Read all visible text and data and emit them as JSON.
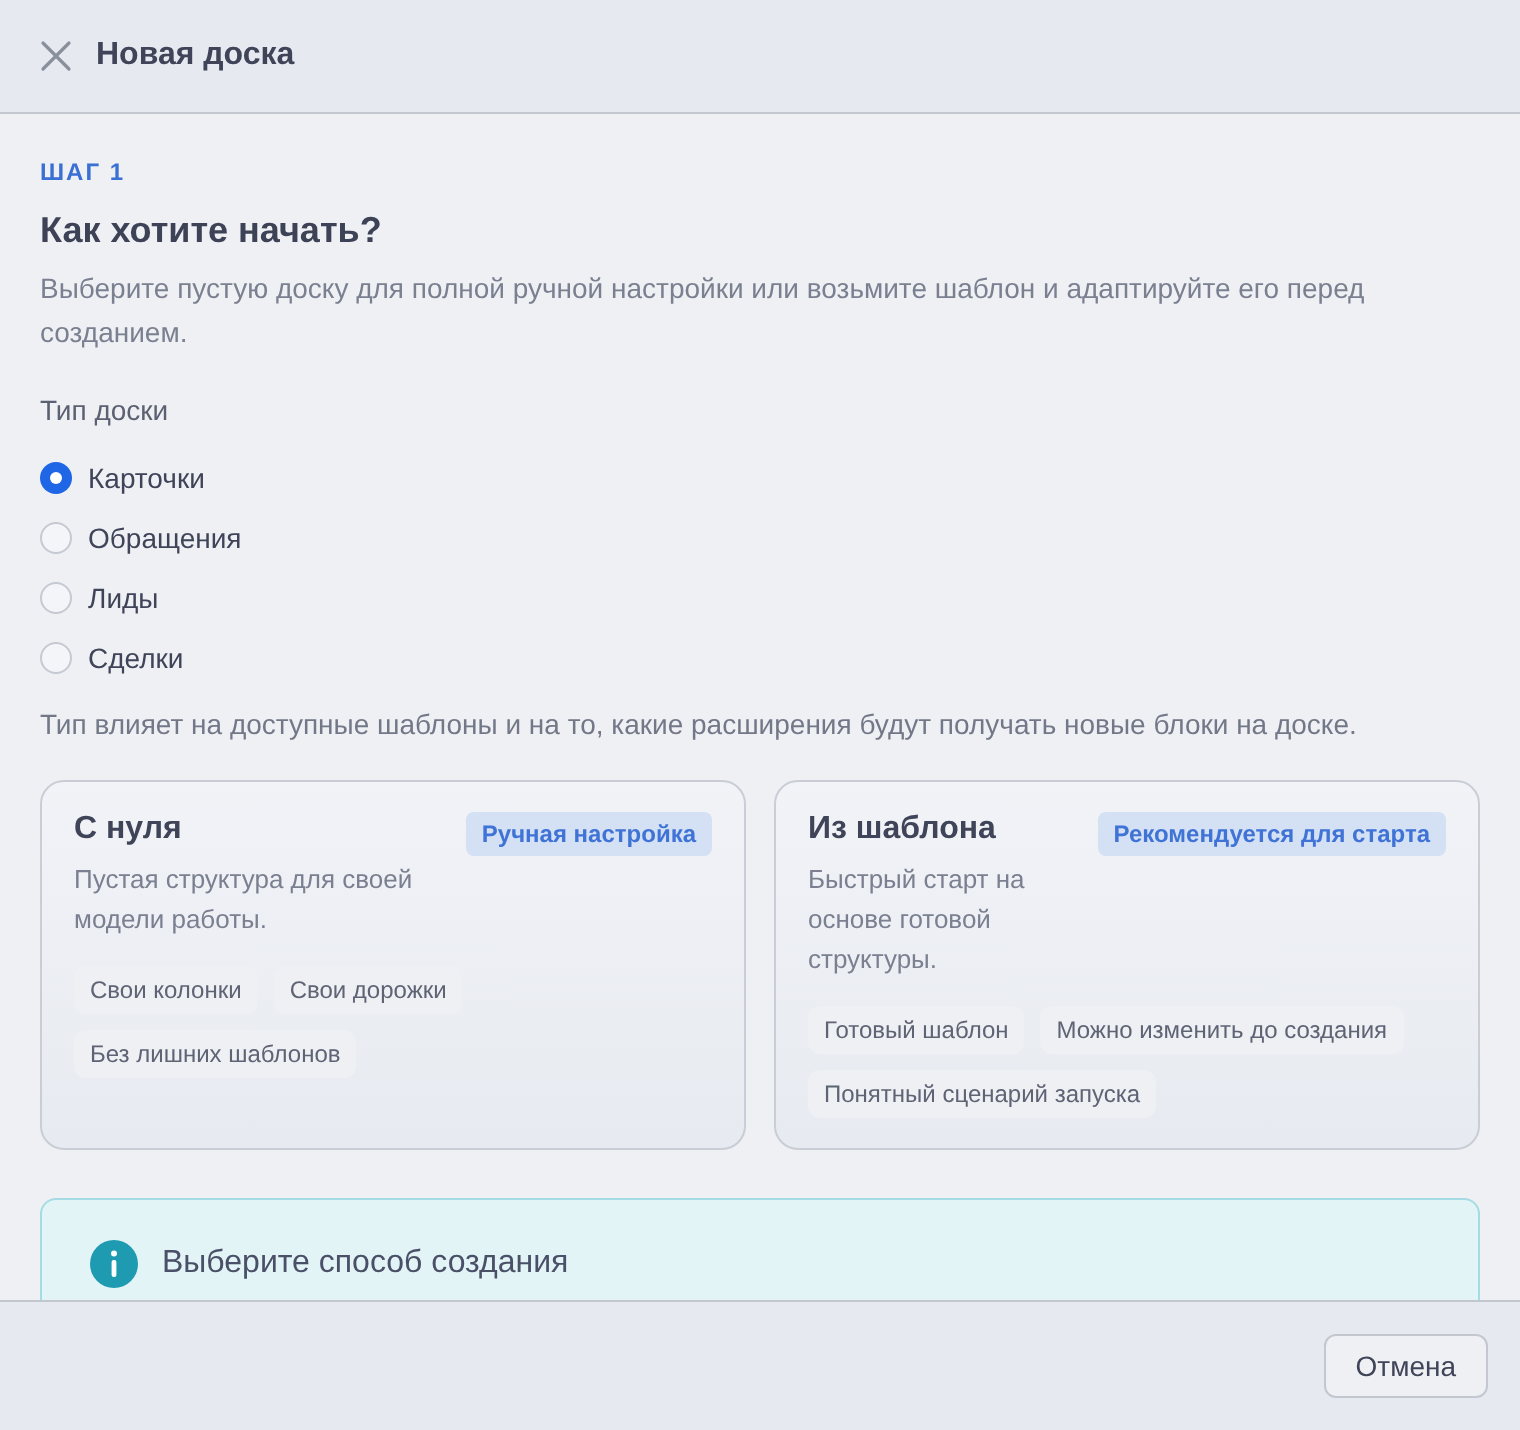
{
  "header": {
    "title": "Новая доска"
  },
  "step": {
    "label": "ШАГ 1",
    "title": "Как хотите начать?",
    "description": "Выберите пустую доску для полной ручной настройки или возьмите шаблон и адаптируйте его перед созданием."
  },
  "board_type": {
    "label": "Тип доски",
    "options": [
      {
        "label": "Карточки",
        "selected": true
      },
      {
        "label": "Обращения",
        "selected": false
      },
      {
        "label": "Лиды",
        "selected": false
      },
      {
        "label": "Сделки",
        "selected": false
      }
    ],
    "hint": "Тип влияет на доступные шаблоны и на то, какие расширения будут получать новые блоки на доске."
  },
  "creation_methods": [
    {
      "title": "С нуля",
      "badge": "Ручная настройка",
      "description": "Пустая структура для своей модели работы.",
      "features": [
        "Свои колонки",
        "Свои дорожки",
        "Без лишних шаблонов"
      ],
      "selected": false
    },
    {
      "title": "Из шаблона",
      "badge": "Рекомендуется для старта",
      "description": "Быстрый старт на основе готовой структуры.",
      "features": [
        "Готовый шаблон",
        "Можно изменить до создания",
        "Понятный сценарий запуска"
      ],
      "selected": false
    }
  ],
  "info": {
    "text": "Выберите способ создания"
  },
  "footer": {
    "cancel_button": "Отмена"
  }
}
